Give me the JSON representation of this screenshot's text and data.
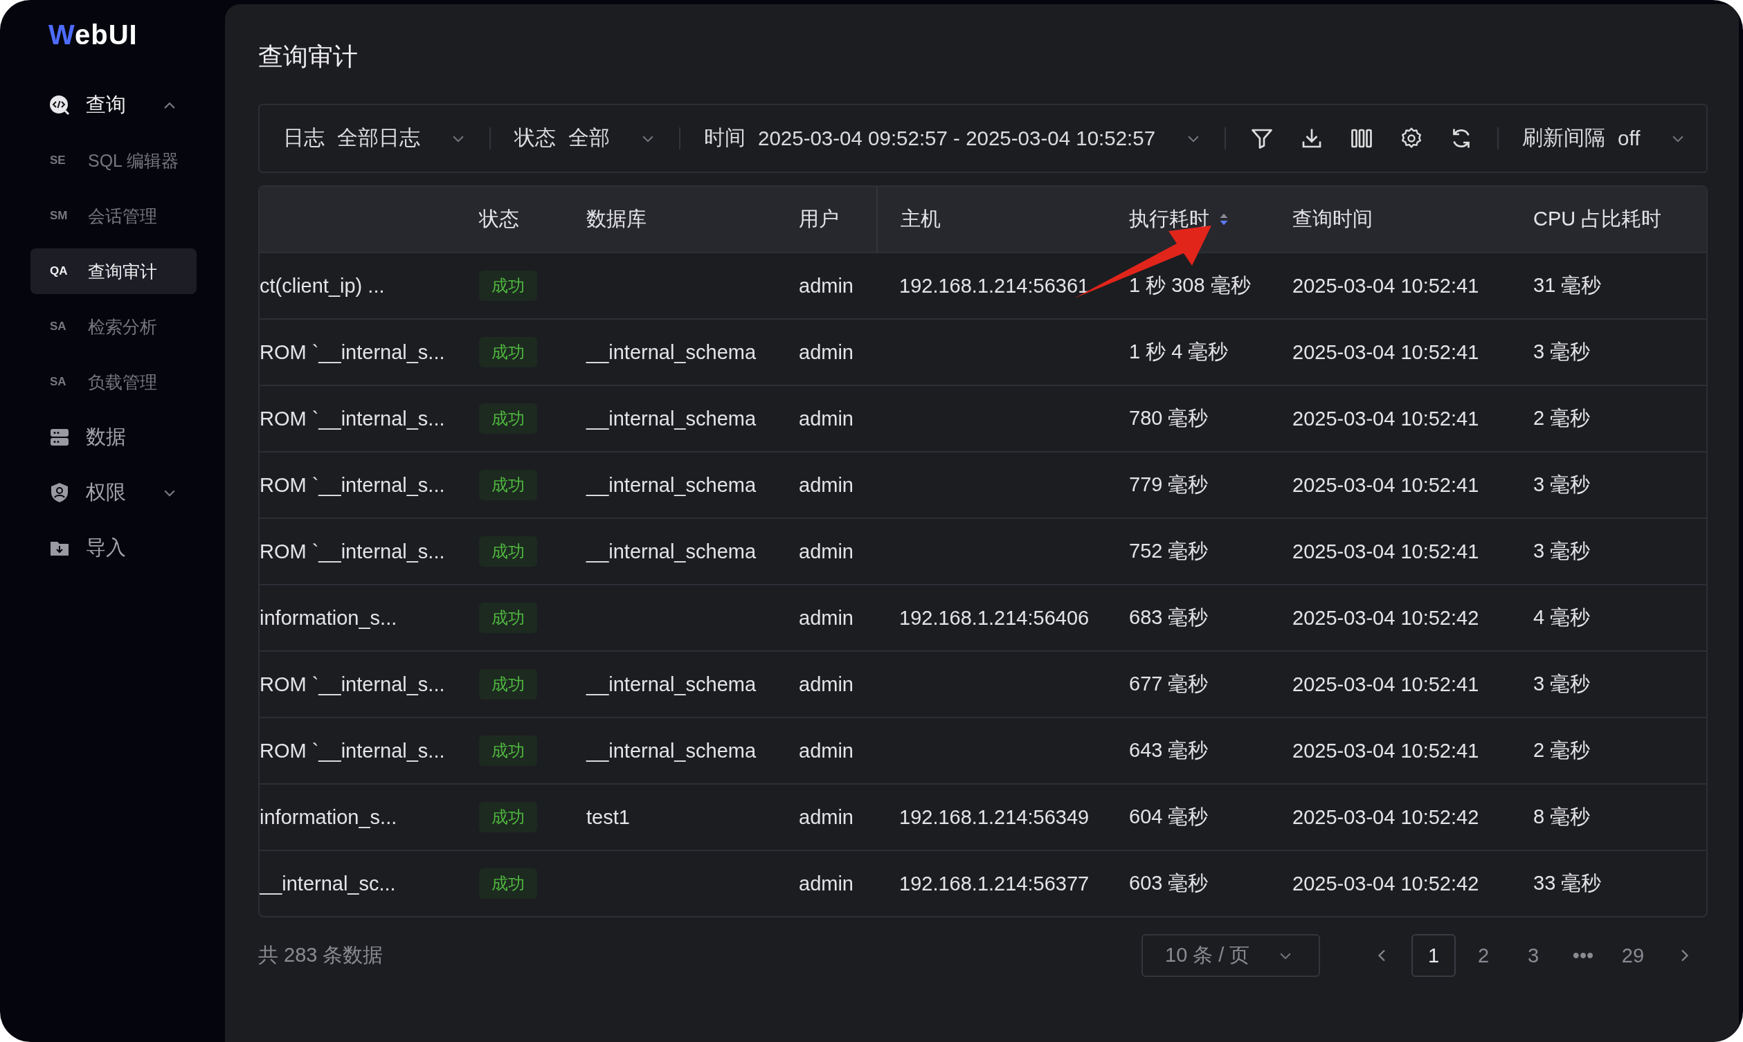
{
  "logo": {
    "text": "WebUI"
  },
  "sidebar": {
    "items": [
      {
        "label": "查询",
        "expanded": true,
        "children": [
          {
            "abbr": "SE",
            "label": "SQL 编辑器",
            "selected": false
          },
          {
            "abbr": "SM",
            "label": "会话管理",
            "selected": false
          },
          {
            "abbr": "QA",
            "label": "查询审计",
            "selected": true
          },
          {
            "abbr": "SA",
            "label": "检索分析",
            "selected": false
          },
          {
            "abbr": "SA",
            "label": "负载管理",
            "selected": false
          }
        ]
      },
      {
        "label": "数据"
      },
      {
        "label": "权限",
        "expanded": false
      },
      {
        "label": "导入"
      }
    ]
  },
  "page": {
    "title": "查询审计"
  },
  "toolbar": {
    "filters": [
      {
        "label": "日志",
        "value": "全部日志"
      },
      {
        "label": "状态",
        "value": "全部"
      },
      {
        "label": "时间",
        "value": "2025-03-04 09:52:57 - 2025-03-04 10:52:57"
      }
    ],
    "refresh": {
      "label": "刷新间隔",
      "value": "off"
    }
  },
  "table": {
    "columns": [
      {},
      {
        "label": "状态"
      },
      {
        "label": "数据库"
      },
      {
        "label": "用户"
      },
      {
        "label": "主机"
      },
      {
        "label": "执行耗时",
        "sorted": true
      },
      {
        "label": "查询时间"
      },
      {
        "label": "CPU 占比耗时"
      }
    ],
    "rows": [
      {
        "query": "ct(client_ip) ...",
        "status": "成功",
        "user": "admin",
        "host": "192.168.1.214:56361",
        "duration": "1 秒 308 毫秒",
        "time": "2025-03-04 10:52:41",
        "cpu": "31 毫秒"
      },
      {
        "query": "ROM `__internal_s...",
        "status": "成功",
        "database": "__internal_schema",
        "user": "admin",
        "duration": "1 秒 4 毫秒",
        "time": "2025-03-04 10:52:41",
        "cpu": "3 毫秒"
      },
      {
        "query": "ROM `__internal_s...",
        "status": "成功",
        "database": "__internal_schema",
        "user": "admin",
        "duration": "780 毫秒",
        "time": "2025-03-04 10:52:41",
        "cpu": "2 毫秒"
      },
      {
        "query": "ROM `__internal_s...",
        "status": "成功",
        "database": "__internal_schema",
        "user": "admin",
        "duration": "779 毫秒",
        "time": "2025-03-04 10:52:41",
        "cpu": "3 毫秒"
      },
      {
        "query": "ROM `__internal_s...",
        "status": "成功",
        "database": "__internal_schema",
        "user": "admin",
        "duration": "752 毫秒",
        "time": "2025-03-04 10:52:41",
        "cpu": "3 毫秒"
      },
      {
        "query": "information_s...",
        "status": "成功",
        "user": "admin",
        "host": "192.168.1.214:56406",
        "duration": "683 毫秒",
        "time": "2025-03-04 10:52:42",
        "cpu": "4 毫秒"
      },
      {
        "query": "ROM `__internal_s...",
        "status": "成功",
        "database": "__internal_schema",
        "user": "admin",
        "duration": "677 毫秒",
        "time": "2025-03-04 10:52:41",
        "cpu": "3 毫秒"
      },
      {
        "query": "ROM `__internal_s...",
        "status": "成功",
        "database": "__internal_schema",
        "user": "admin",
        "duration": "643 毫秒",
        "time": "2025-03-04 10:52:41",
        "cpu": "2 毫秒"
      },
      {
        "query": "information_s...",
        "status": "成功",
        "database": "test1",
        "user": "admin",
        "host": "192.168.1.214:56349",
        "duration": "604 毫秒",
        "time": "2025-03-04 10:52:42",
        "cpu": "8 毫秒"
      },
      {
        "query": "__internal_sc...",
        "status": "成功",
        "user": "admin",
        "host": "192.168.1.214:56377",
        "duration": "603 毫秒",
        "time": "2025-03-04 10:52:42",
        "cpu": "33 毫秒"
      }
    ]
  },
  "footer": {
    "total": "共 283 条数据",
    "page_size": "10 条 / 页",
    "pages": [
      {
        "label": "1",
        "selected": true
      },
      {
        "label": "2",
        "selected": false
      },
      {
        "label": "3",
        "selected": false
      },
      {
        "label": "•••",
        "selected": false
      },
      {
        "label": "29",
        "selected": false
      }
    ]
  },
  "annotation": {
    "kind": "arrow"
  }
}
